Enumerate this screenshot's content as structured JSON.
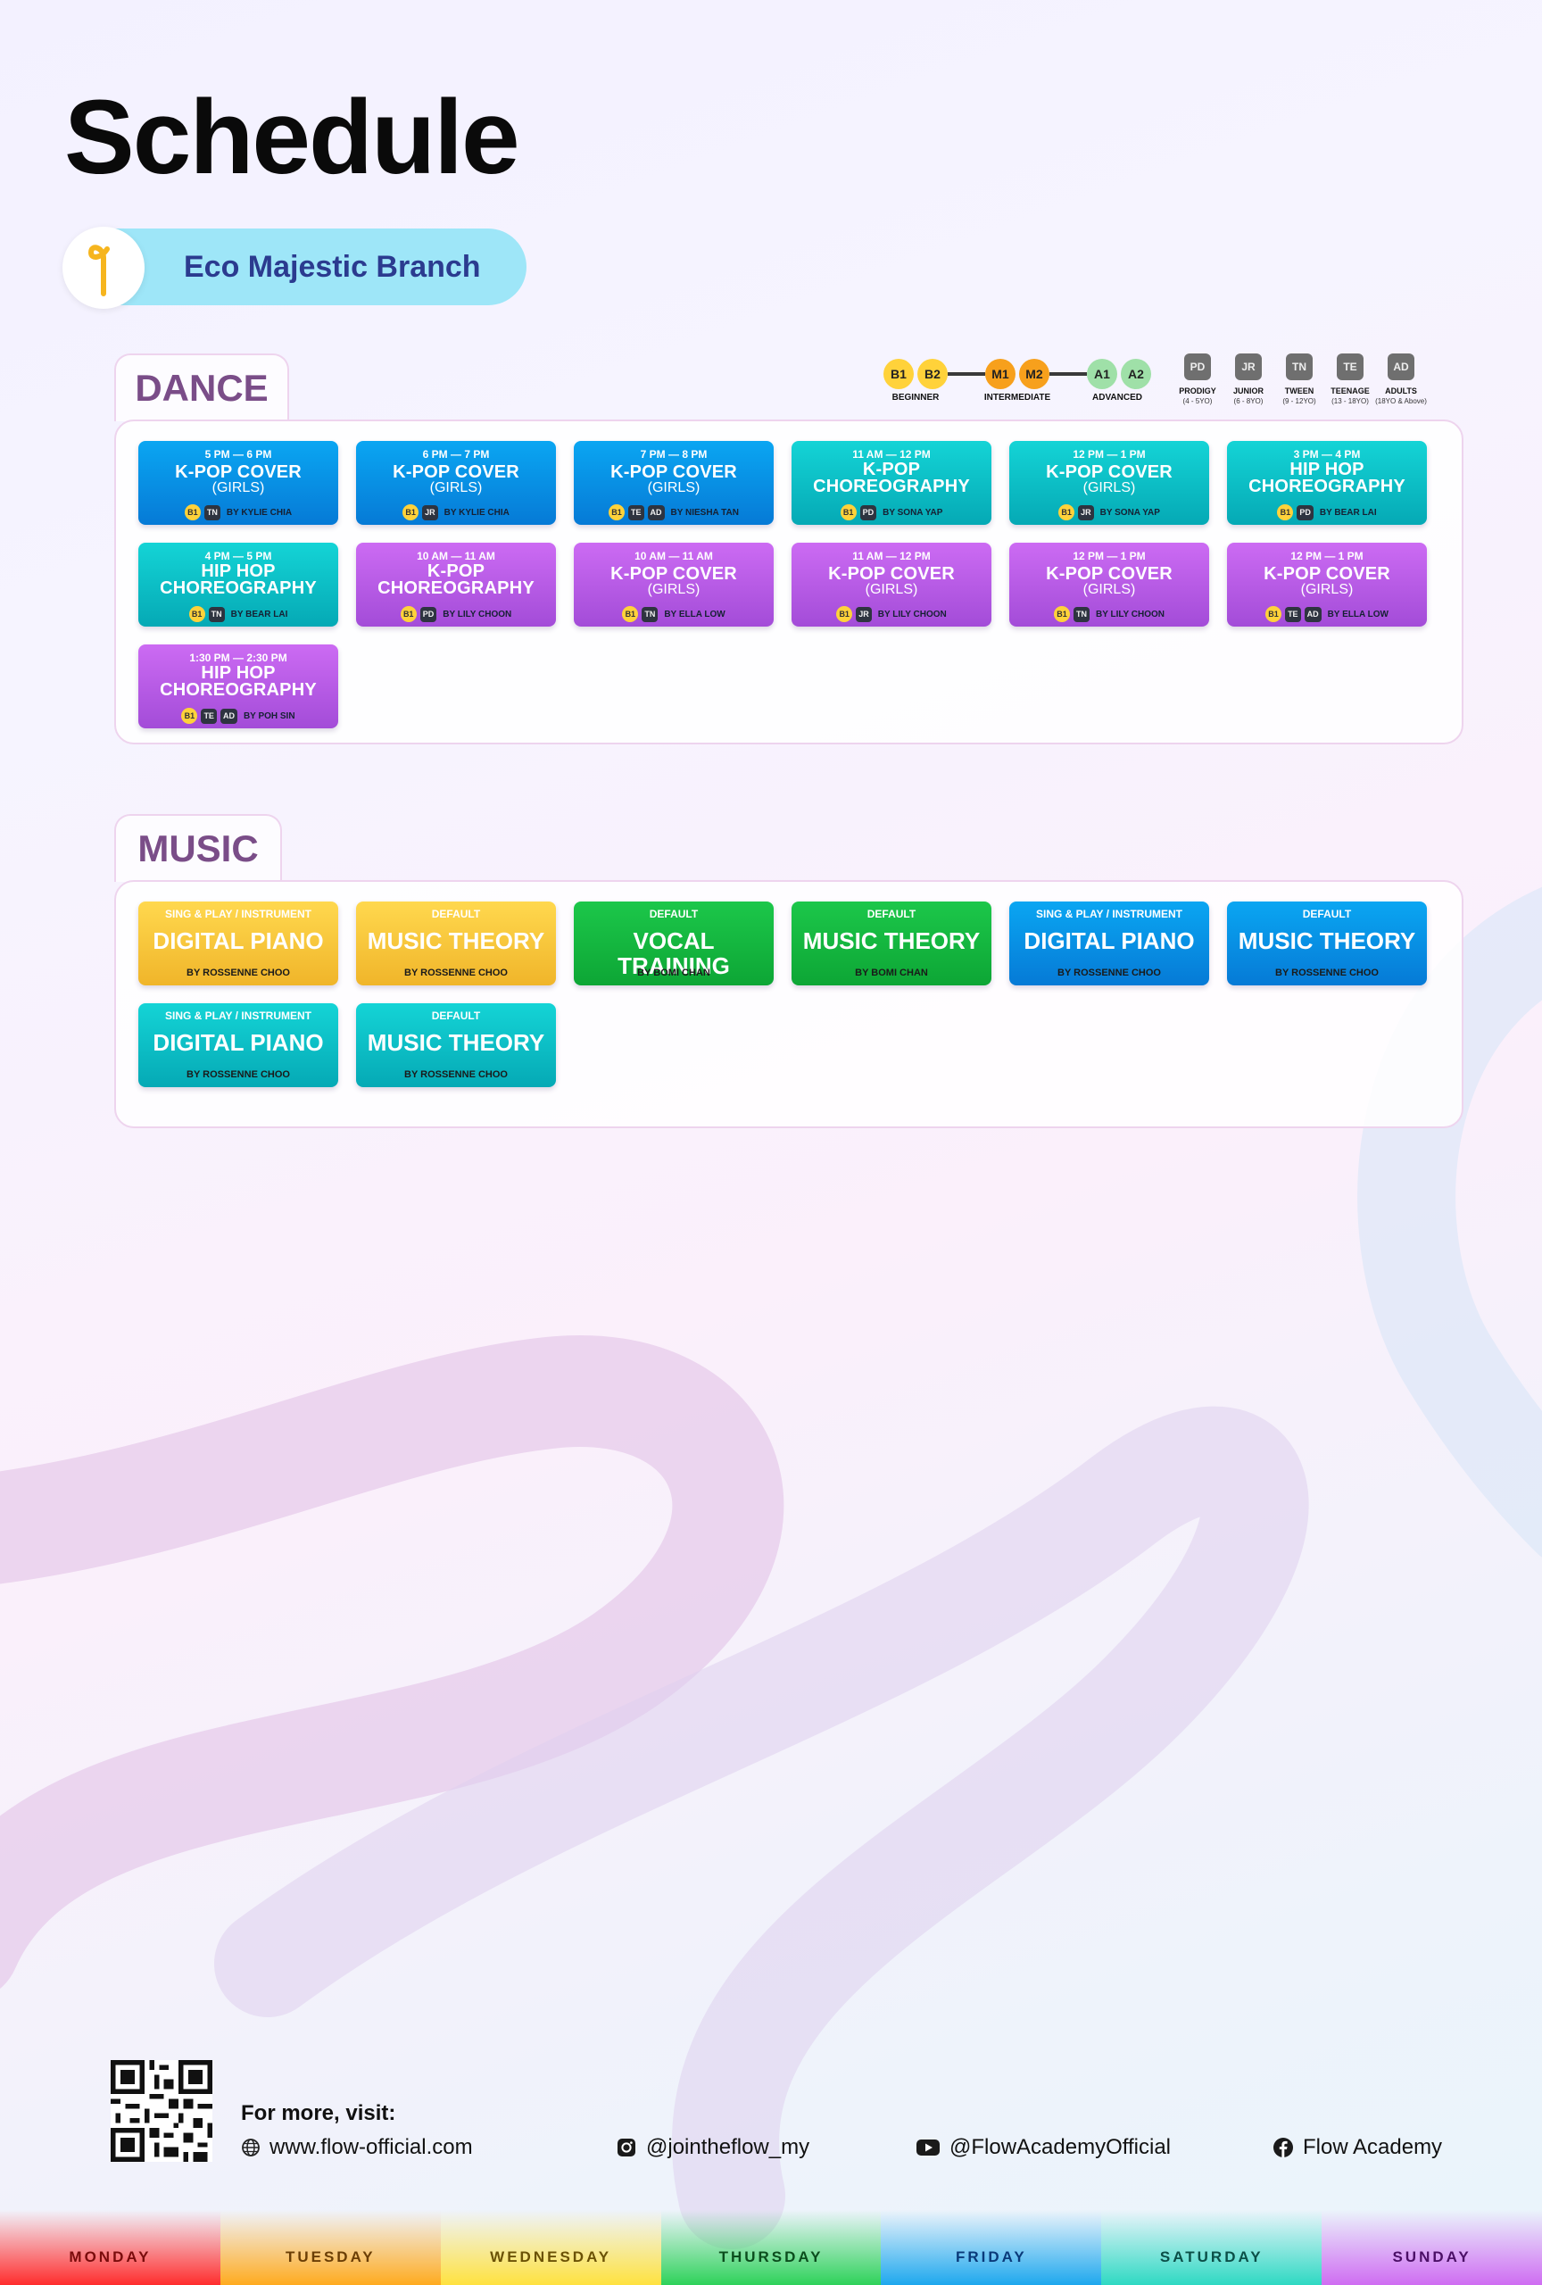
{
  "page": {
    "title": "Schedule",
    "branch": "Eco Majestic Branch"
  },
  "sections": {
    "dance": "DANCE",
    "music": "MUSIC"
  },
  "legend": {
    "levels": [
      {
        "code": "B1",
        "group": "beginner",
        "color": "#ffd23a"
      },
      {
        "code": "B2",
        "group": "beginner",
        "color": "#ffd23a"
      },
      {
        "code": "M1",
        "group": "intermediate",
        "color": "#f7a01c"
      },
      {
        "code": "M2",
        "group": "intermediate",
        "color": "#f7a01c"
      },
      {
        "code": "A1",
        "group": "advanced",
        "color": "#9fe0a8"
      },
      {
        "code": "A2",
        "group": "advanced",
        "color": "#9fe0a8"
      }
    ],
    "level_groups": {
      "beginner": "BEGINNER",
      "intermediate": "INTERMEDIATE",
      "advanced": "ADVANCED"
    },
    "ages": [
      {
        "code": "PD",
        "name": "PRODIGY",
        "range": "(4 - 5YO)"
      },
      {
        "code": "JR",
        "name": "JUNIOR",
        "range": "(6 - 8YO)"
      },
      {
        "code": "TN",
        "name": "TWEEN",
        "range": "(9 - 12YO)"
      },
      {
        "code": "TE",
        "name": "TEENAGE",
        "range": "(13 - 18YO)"
      },
      {
        "code": "AD",
        "name": "ADULTS",
        "range": "(18YO & Above)"
      }
    ]
  },
  "dance": [
    {
      "color": "blue",
      "time": "5 PM — 6 PM",
      "title": "K-POP COVER",
      "sub": "(GIRLS)",
      "level": "B1",
      "ages": [
        "TN"
      ],
      "by": "BY KYLIE CHIA"
    },
    {
      "color": "blue",
      "time": "6 PM — 7 PM",
      "title": "K-POP COVER",
      "sub": "(GIRLS)",
      "level": "B1",
      "ages": [
        "JR"
      ],
      "by": "BY KYLIE CHIA"
    },
    {
      "color": "blue",
      "time": "7 PM — 8 PM",
      "title": "K-POP COVER",
      "sub": "(GIRLS)",
      "level": "B1",
      "ages": [
        "TE",
        "AD"
      ],
      "by": "BY NIESHA TAN"
    },
    {
      "color": "teal",
      "time": "11 AM — 12 PM",
      "title": "K-POP CHOREOGRAPHY",
      "sub": "",
      "level": "B1",
      "ages": [
        "PD"
      ],
      "by": "BY SONA YAP"
    },
    {
      "color": "teal",
      "time": "12 PM — 1 PM",
      "title": "K-POP COVER",
      "sub": "(GIRLS)",
      "level": "B1",
      "ages": [
        "JR"
      ],
      "by": "BY SONA YAP"
    },
    {
      "color": "teal",
      "time": "3 PM — 4 PM",
      "title": "HIP HOP CHOREOGRAPHY",
      "sub": "",
      "level": "B1",
      "ages": [
        "PD"
      ],
      "by": "BY BEAR LAI"
    },
    {
      "color": "teal",
      "time": "4 PM — 5 PM",
      "title": "HIP HOP CHOREOGRAPHY",
      "sub": "",
      "level": "B1",
      "ages": [
        "TN"
      ],
      "by": "BY BEAR LAI"
    },
    {
      "color": "purple",
      "time": "10 AM — 11 AM",
      "title": "K-POP CHOREOGRAPHY",
      "sub": "",
      "level": "B1",
      "ages": [
        "PD"
      ],
      "by": "BY LILY CHOON"
    },
    {
      "color": "purple",
      "time": "10 AM — 11 AM",
      "title": "K-POP COVER",
      "sub": "(GIRLS)",
      "level": "B1",
      "ages": [
        "TN"
      ],
      "by": "BY ELLA LOW"
    },
    {
      "color": "purple",
      "time": "11 AM — 12 PM",
      "title": "K-POP COVER",
      "sub": "(GIRLS)",
      "level": "B1",
      "ages": [
        "JR"
      ],
      "by": "BY LILY CHOON"
    },
    {
      "color": "purple",
      "time": "12 PM — 1 PM",
      "title": "K-POP COVER",
      "sub": "(GIRLS)",
      "level": "B1",
      "ages": [
        "TN"
      ],
      "by": "BY LILY CHOON"
    },
    {
      "color": "purple",
      "time": "12 PM — 1 PM",
      "title": "K-POP COVER",
      "sub": "(GIRLS)",
      "level": "B1",
      "ages": [
        "TE",
        "AD"
      ],
      "by": "BY ELLA LOW"
    },
    {
      "color": "purple",
      "time": "1:30 PM — 2:30 PM",
      "title": "HIP HOP CHOREOGRAPHY",
      "sub": "",
      "level": "B1",
      "ages": [
        "TE",
        "AD"
      ],
      "by": "BY POH SIN"
    }
  ],
  "music": [
    {
      "color": "yellow",
      "cat": "SING & PLAY / INSTRUMENT",
      "title": "DIGITAL PIANO",
      "by": "BY ROSSENNE CHOO"
    },
    {
      "color": "yellow",
      "cat": "DEFAULT",
      "title": "MUSIC THEORY",
      "by": "BY ROSSENNE CHOO"
    },
    {
      "color": "green",
      "cat": "DEFAULT",
      "title": "VOCAL TRAINING",
      "by": "BY BOMI CHAN"
    },
    {
      "color": "green",
      "cat": "DEFAULT",
      "title": "MUSIC THEORY",
      "by": "BY BOMI CHAN"
    },
    {
      "color": "blue",
      "cat": "SING & PLAY / INSTRUMENT",
      "title": "DIGITAL PIANO",
      "by": "BY ROSSENNE CHOO"
    },
    {
      "color": "blue",
      "cat": "DEFAULT",
      "title": "MUSIC THEORY",
      "by": "BY ROSSENNE CHOO"
    },
    {
      "color": "teal",
      "cat": "SING & PLAY / INSTRUMENT",
      "title": "DIGITAL PIANO",
      "by": "BY ROSSENNE CHOO"
    },
    {
      "color": "teal",
      "cat": "DEFAULT",
      "title": "MUSIC THEORY",
      "by": "BY ROSSENNE CHOO"
    }
  ],
  "footer": {
    "lead": "For more, visit:",
    "website": {
      "icon": "globe-icon",
      "text": "www.flow-official.com"
    },
    "instagram": {
      "icon": "instagram-icon",
      "text": "@jointheflow_my"
    },
    "youtube": {
      "icon": "youtube-icon",
      "text": "@FlowAcademyOfficial"
    },
    "facebook": {
      "icon": "facebook-icon",
      "text": "Flow Academy"
    }
  },
  "days": [
    {
      "label": "MONDAY",
      "bg": "#ff2d2d",
      "fg": "#7a0c0c"
    },
    {
      "label": "TUESDAY",
      "bg": "#ffab1f",
      "fg": "#6b3e05"
    },
    {
      "label": "WEDNESDAY",
      "bg": "#ffe23f",
      "fg": "#6b5205"
    },
    {
      "label": "THURSDAY",
      "bg": "#2ed25a",
      "fg": "#0b4d1d"
    },
    {
      "label": "FRIDAY",
      "bg": "#1ea8ee",
      "fg": "#0a3a7a"
    },
    {
      "label": "SATURDAY",
      "bg": "#2ed9c3",
      "fg": "#0b4f48"
    },
    {
      "label": "SUNDAY",
      "bg": "#cf6df2",
      "fg": "#4b0f66"
    }
  ]
}
